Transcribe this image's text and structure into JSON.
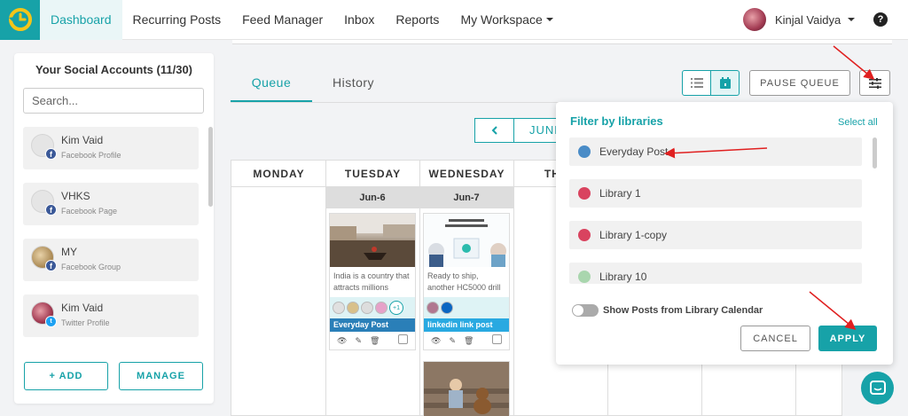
{
  "nav": {
    "items": [
      {
        "label": "Dashboard",
        "active": true
      },
      {
        "label": "Recurring Posts"
      },
      {
        "label": "Feed Manager"
      },
      {
        "label": "Inbox"
      },
      {
        "label": "Reports"
      },
      {
        "label": "My Workspace"
      }
    ],
    "user_name": "Kinjal Vaidya",
    "help": "?"
  },
  "sidebar": {
    "title": "Your Social Accounts (11/30)",
    "search_placeholder": "Search...",
    "accounts": [
      {
        "name": "Kim Vaid",
        "type": "Facebook Profile",
        "network": "facebook"
      },
      {
        "name": "VHKS",
        "type": "Facebook Page",
        "network": "facebook"
      },
      {
        "name": "MY",
        "type": "Facebook Group",
        "network": "facebook"
      },
      {
        "name": "Kim Vaid",
        "type": "Twitter Profile",
        "network": "twitter"
      }
    ],
    "add_label": "+ ADD",
    "manage_label": "MANAGE"
  },
  "main": {
    "tabs": [
      "Queue",
      "History"
    ],
    "pause_label": "PAUSE QUEUE",
    "month_label": "JUNE",
    "days": [
      "MONDAY",
      "TUESDAY",
      "WEDNESDAY",
      "THUR"
    ],
    "dates": {
      "tuesday": "Jun-6",
      "wednesday": "Jun-7"
    },
    "posts": [
      {
        "text": "India is a country that attracts millions",
        "library": "Everyday Post",
        "lib_color": "#2a7fb8",
        "more": "+1"
      },
      {
        "text": "Ready to ship, another HC5000 drill",
        "library": "linkedin link post",
        "lib_color": "#29a9e1"
      }
    ]
  },
  "filter": {
    "title": "Filter by libraries",
    "select_all": "Select all",
    "libraries": [
      {
        "name": "Everyday Post",
        "color": "#4a8cc7"
      },
      {
        "name": "Library 1",
        "color": "#d9435f"
      },
      {
        "name": "Library 1-copy",
        "color": "#d9435f"
      },
      {
        "name": "Library 10",
        "color": "#a9d6ae"
      }
    ],
    "toggle_label": "Show Posts from Library Calendar",
    "cancel_label": "CANCEL",
    "apply_label": "APPLY"
  },
  "colors": {
    "accent": "#17a2a8",
    "annotation": "#e02020"
  }
}
